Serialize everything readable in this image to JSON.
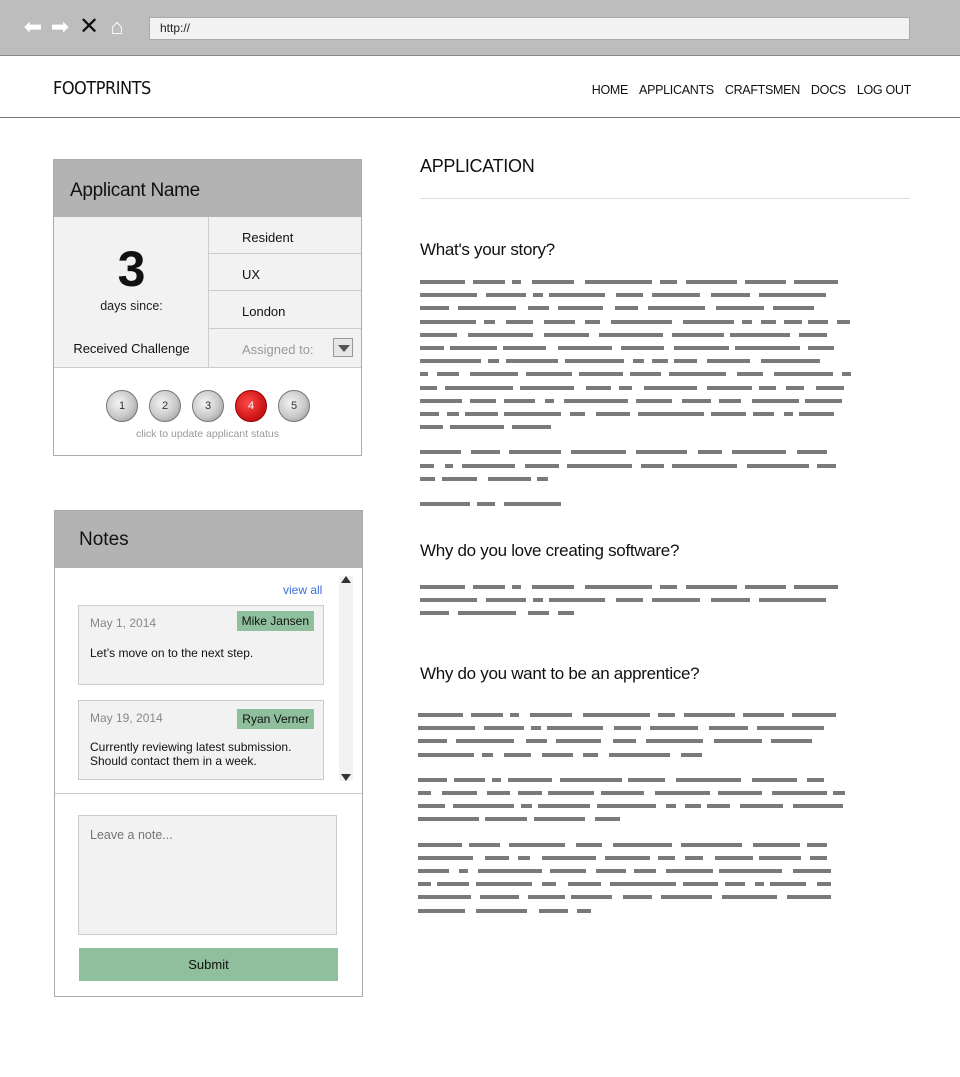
{
  "browser": {
    "url": "http://",
    "icons": [
      "back-arrow-icon",
      "forward-arrow-icon",
      "close-icon",
      "home-icon"
    ]
  },
  "header": {
    "brand": "FOOTPRINTS",
    "nav": [
      "HOME",
      "APPLICANTS",
      "CRAFTSMEN",
      "DOCS",
      "LOG OUT"
    ]
  },
  "applicant": {
    "name": "Applicant Name",
    "days": "3",
    "days_label": "days since:",
    "status": "Received Challenge",
    "info": [
      "Resident",
      "UX",
      "London"
    ],
    "assigned_placeholder": "Assigned to:",
    "steps": [
      "1",
      "2",
      "3",
      "4",
      "5"
    ],
    "active_step": "4",
    "steps_hint": "click to update applicant status"
  },
  "notes": {
    "title": "Notes",
    "view_all": "view all",
    "items": [
      {
        "date": "May 1, 2014",
        "author": "Mike Jansen",
        "text": "Let’s move on to the next step."
      },
      {
        "date": "May 19, 2014",
        "author": "Ryan Verner",
        "text": "Currently reviewing latest submission. Should contact them in a week."
      }
    ],
    "input_placeholder": "Leave a note...",
    "submit_label": "Submit"
  },
  "application": {
    "title": "APPLICATION",
    "questions": [
      "What's your story?",
      "Why do you love creating software?",
      "Why do you want to be an apprentice?"
    ]
  },
  "colors": {
    "accent_green": "#8fbf9d",
    "active_step_red": "#d41c1c",
    "link_blue": "#3b6fd6",
    "card_header_gray": "#b3b3b3"
  }
}
